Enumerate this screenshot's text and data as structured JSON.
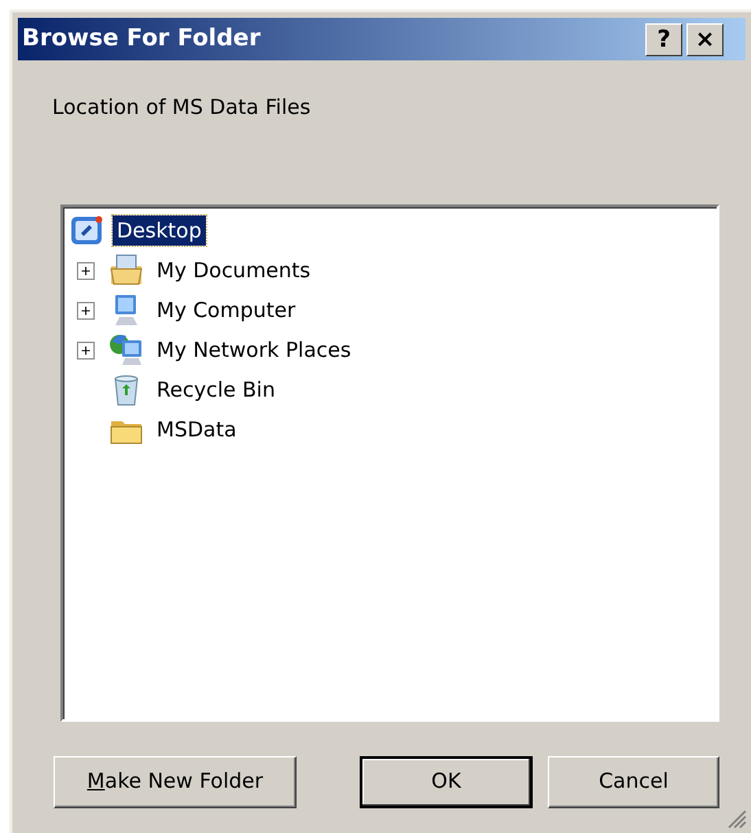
{
  "window": {
    "title": "Browse For Folder",
    "title_buttons": [
      {
        "label": "?"
      },
      {
        "label": "×"
      }
    ]
  },
  "prompt": "Location of MS Data Files",
  "tree": [
    {
      "label": "Desktop",
      "kind": "desktop",
      "selected": true,
      "children": [
        {
          "label": "My Documents",
          "kind": "documents",
          "expandable": true,
          "selected": false
        },
        {
          "label": "My Computer",
          "kind": "computer",
          "expandable": true,
          "selected": false
        },
        {
          "label": "My Network Places",
          "kind": "network",
          "expandable": true,
          "selected": false
        },
        {
          "label": "Recycle Bin",
          "kind": "recycle",
          "expandable": false,
          "selected": false
        },
        {
          "label": "MSData",
          "kind": "folder",
          "expandable": false,
          "selected": false
        }
      ]
    }
  ],
  "buttons": [
    {
      "label": "Make New Folder",
      "underline_first": true,
      "default": false
    },
    {
      "label": "OK",
      "underline_first": false,
      "default": true
    },
    {
      "label": "Cancel",
      "underline_first": false,
      "default": false
    }
  ]
}
